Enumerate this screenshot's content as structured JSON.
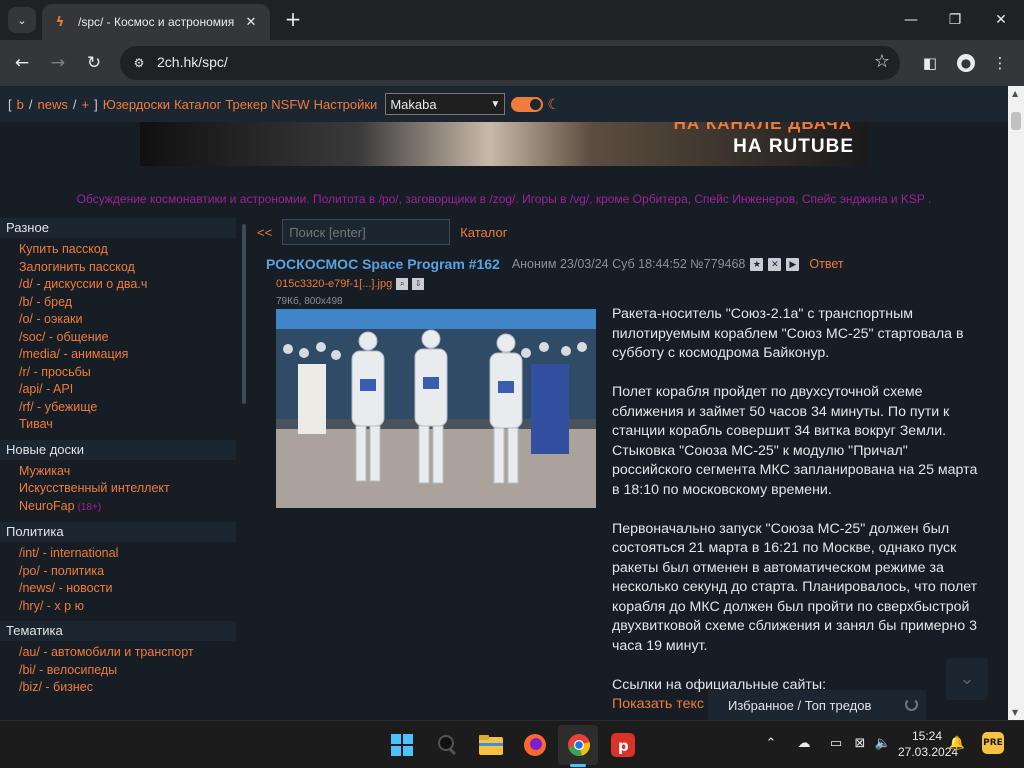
{
  "browser": {
    "tab_title": "/spc/ - Космос и астрономия",
    "url": "2ch.hk/spc/"
  },
  "topnav": {
    "links": [
      "b",
      "news",
      "+"
    ],
    "menu": [
      "Юзердоски",
      "Каталог",
      "Трекер",
      "NSFW",
      "Настройки"
    ],
    "style_select": "Makaba"
  },
  "banner": {
    "line1": "НА КАНАЛЕ ДВАЧА",
    "line2": "НА RUTUBE"
  },
  "board_description": "Обсуждение космонавтики и астрономии. Политота в /po/, заговорщики в /zog/. Игоры в /vg/, кроме Орбитера, Спейс Инженеров, Спейс энджина и KSP .",
  "sidebar": {
    "groups": [
      {
        "title": "Разное",
        "items": [
          "Купить пасскод",
          "Залогинить пасскод",
          "/d/ - дискуссии о два.ч",
          "/b/ - бред",
          "/o/ - оэкаки",
          "/soc/ - общение",
          "/media/ - анимация",
          "/r/ - просьбы",
          "/api/ - API",
          "/rf/ - убежище",
          "Тивач"
        ]
      },
      {
        "title": "Новые доски",
        "items": [
          "Мужикач",
          "Искусственный интеллект",
          "NeuroFap"
        ],
        "tag": "(18+)"
      },
      {
        "title": "Политика",
        "items": [
          "/int/ - international",
          "/po/ - политика",
          "/news/ - новости",
          "/hry/ - х р ю"
        ]
      },
      {
        "title": "Тематика",
        "items": [
          "/au/ - автомобили и транспорт",
          "/bi/ - велосипеды",
          "/biz/ - бизнес"
        ]
      }
    ]
  },
  "thread_bar": {
    "back": "<<",
    "search_placeholder": "Поиск [enter]",
    "catalog": "Каталог"
  },
  "post": {
    "title": "РОСКОСМОС Space Program #162",
    "meta": "Аноним 23/03/24 Суб 18:44:52 №779468",
    "reply": "Ответ",
    "file_name": "015c3320-e79f-1[...].jpg",
    "file_meta": "79Кб, 800x498",
    "paragraphs": [
      "Ракета-носитель \"Союз-2.1а\" с транспортным пилотируемым кораблем \"Союз МС-25\" стартовала в субботу с космодрома Байконур.",
      "Полет корабля пройдет по двухсуточной схеме сближения и займет 50 часов 34 минуты. По пути к станции корабль совершит 34 витка вокруг Земли. Стыковка \"Союза МС-25\" к модулю \"Причал\" российского сегмента МКС запланирована на 25 марта в 18:10 по московскому времени.",
      "Первоначально запуск \"Союза МС-25\" должен был состояться 21 марта в 16:21 по Москве, однако пуск ракеты был отменен в автоматическом режиме за несколько секунд до старта. Планировалось, что полет корабля до МКС должен был пройти по сверхбыстрой двухвитковой схеме сближения и занял бы примерно 3 часа 19 минут.",
      "Ссылки на официальные сайты:"
    ],
    "show_text": "Показать текс"
  },
  "favorites_bar": "Избранное / Топ тредов",
  "taskbar": {
    "time": "15:24",
    "date": "27.03.2024"
  },
  "colors": {
    "accent": "#f07c3c",
    "title_blue": "#5aa3e0",
    "description_purple": "#a0219a",
    "page_bg": "#161d24"
  }
}
